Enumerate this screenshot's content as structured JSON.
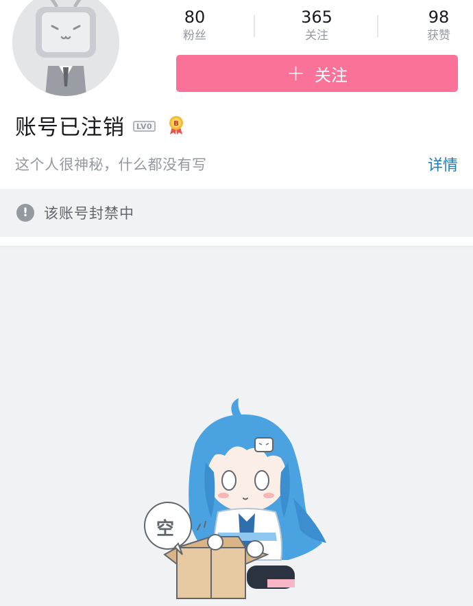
{
  "profile": {
    "username": "账号已注销",
    "level": "LV0",
    "bio": "这个人很神秘，什么都没有写",
    "detail_link": "详情",
    "avatar_icon": "bilibili-tv-avatar-icon",
    "medal_icon": "medal-icon"
  },
  "stats": [
    {
      "value": "80",
      "label": "粉丝"
    },
    {
      "value": "365",
      "label": "关注"
    },
    {
      "value": "98",
      "label": "获赞"
    }
  ],
  "follow_button": {
    "icon": "+",
    "label": "关注"
  },
  "notice": {
    "icon": "!",
    "text": "该账号封禁中"
  },
  "empty_state": {
    "bubble_text": "空",
    "illustration": "empty-box-mascot-illustration"
  },
  "colors": {
    "accent_pink": "#fb7299",
    "link_blue": "#1c7cb3",
    "text_gray": "#9499a0",
    "background": "#f1f2f4"
  }
}
